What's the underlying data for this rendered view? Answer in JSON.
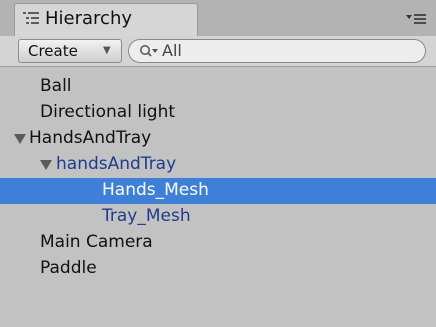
{
  "window": {
    "tab_title": "Hierarchy",
    "tab_icon": "hierarchy-list-icon",
    "menu_icon": "tab-menu-icon"
  },
  "toolbar": {
    "create_label": "Create",
    "create_dropdown_icon": "chevron-down-icon",
    "search": {
      "icon": "search-icon",
      "value": "All"
    }
  },
  "tree": {
    "items": [
      {
        "label": "Ball",
        "depth": 0,
        "expanded": null,
        "selected": false,
        "prefab": false
      },
      {
        "label": "Directional light",
        "depth": 0,
        "expanded": null,
        "selected": false,
        "prefab": false
      },
      {
        "label": "HandsAndTray",
        "depth": 0,
        "expanded": true,
        "selected": false,
        "prefab": false
      },
      {
        "label": "handsAndTray",
        "depth": 1,
        "expanded": true,
        "selected": false,
        "prefab": true
      },
      {
        "label": "Hands_Mesh",
        "depth": 2,
        "expanded": null,
        "selected": true,
        "prefab": true
      },
      {
        "label": "Tray_Mesh",
        "depth": 2,
        "expanded": null,
        "selected": false,
        "prefab": true
      },
      {
        "label": "Main Camera",
        "depth": 0,
        "expanded": null,
        "selected": false,
        "prefab": false
      },
      {
        "label": "Paddle",
        "depth": 0,
        "expanded": null,
        "selected": false,
        "prefab": false
      }
    ]
  },
  "colors": {
    "selection": "#3e7fd9",
    "prefab_text": "#1d3c8f",
    "panel_background": "#c2c2c2"
  }
}
